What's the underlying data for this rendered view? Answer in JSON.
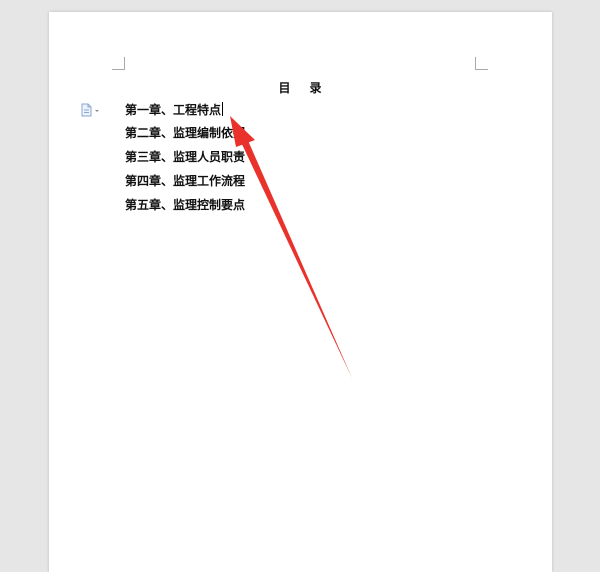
{
  "document": {
    "title_char_1": "目",
    "title_char_2": "录",
    "toc": [
      {
        "label": "第一章、工程特点"
      },
      {
        "label": "第二章、监理编制依据"
      },
      {
        "label": "第三章、监理人员职责"
      },
      {
        "label": "第四章、监理工作流程"
      },
      {
        "label": "第五章、监理控制要点"
      }
    ]
  },
  "icons": {
    "paragraph_handle": "document-icon",
    "annotation": "red-arrow-icon"
  },
  "colors": {
    "background": "#e6e6e6",
    "page": "#ffffff",
    "arrow": "#e8322b"
  }
}
